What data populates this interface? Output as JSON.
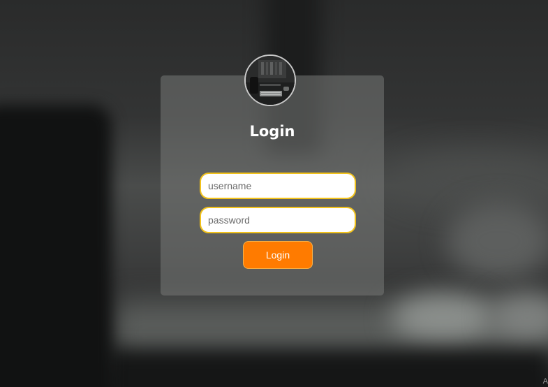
{
  "login": {
    "title": "Login",
    "username_placeholder": "username",
    "password_placeholder": "password",
    "submit_label": "Login"
  },
  "colors": {
    "accent": "#ff7b00",
    "field_border": "#f2c21b",
    "title_text": "#ffffff"
  },
  "icons": {
    "avatar": "workspace-photo"
  },
  "footer": {
    "corner_text": "A"
  }
}
